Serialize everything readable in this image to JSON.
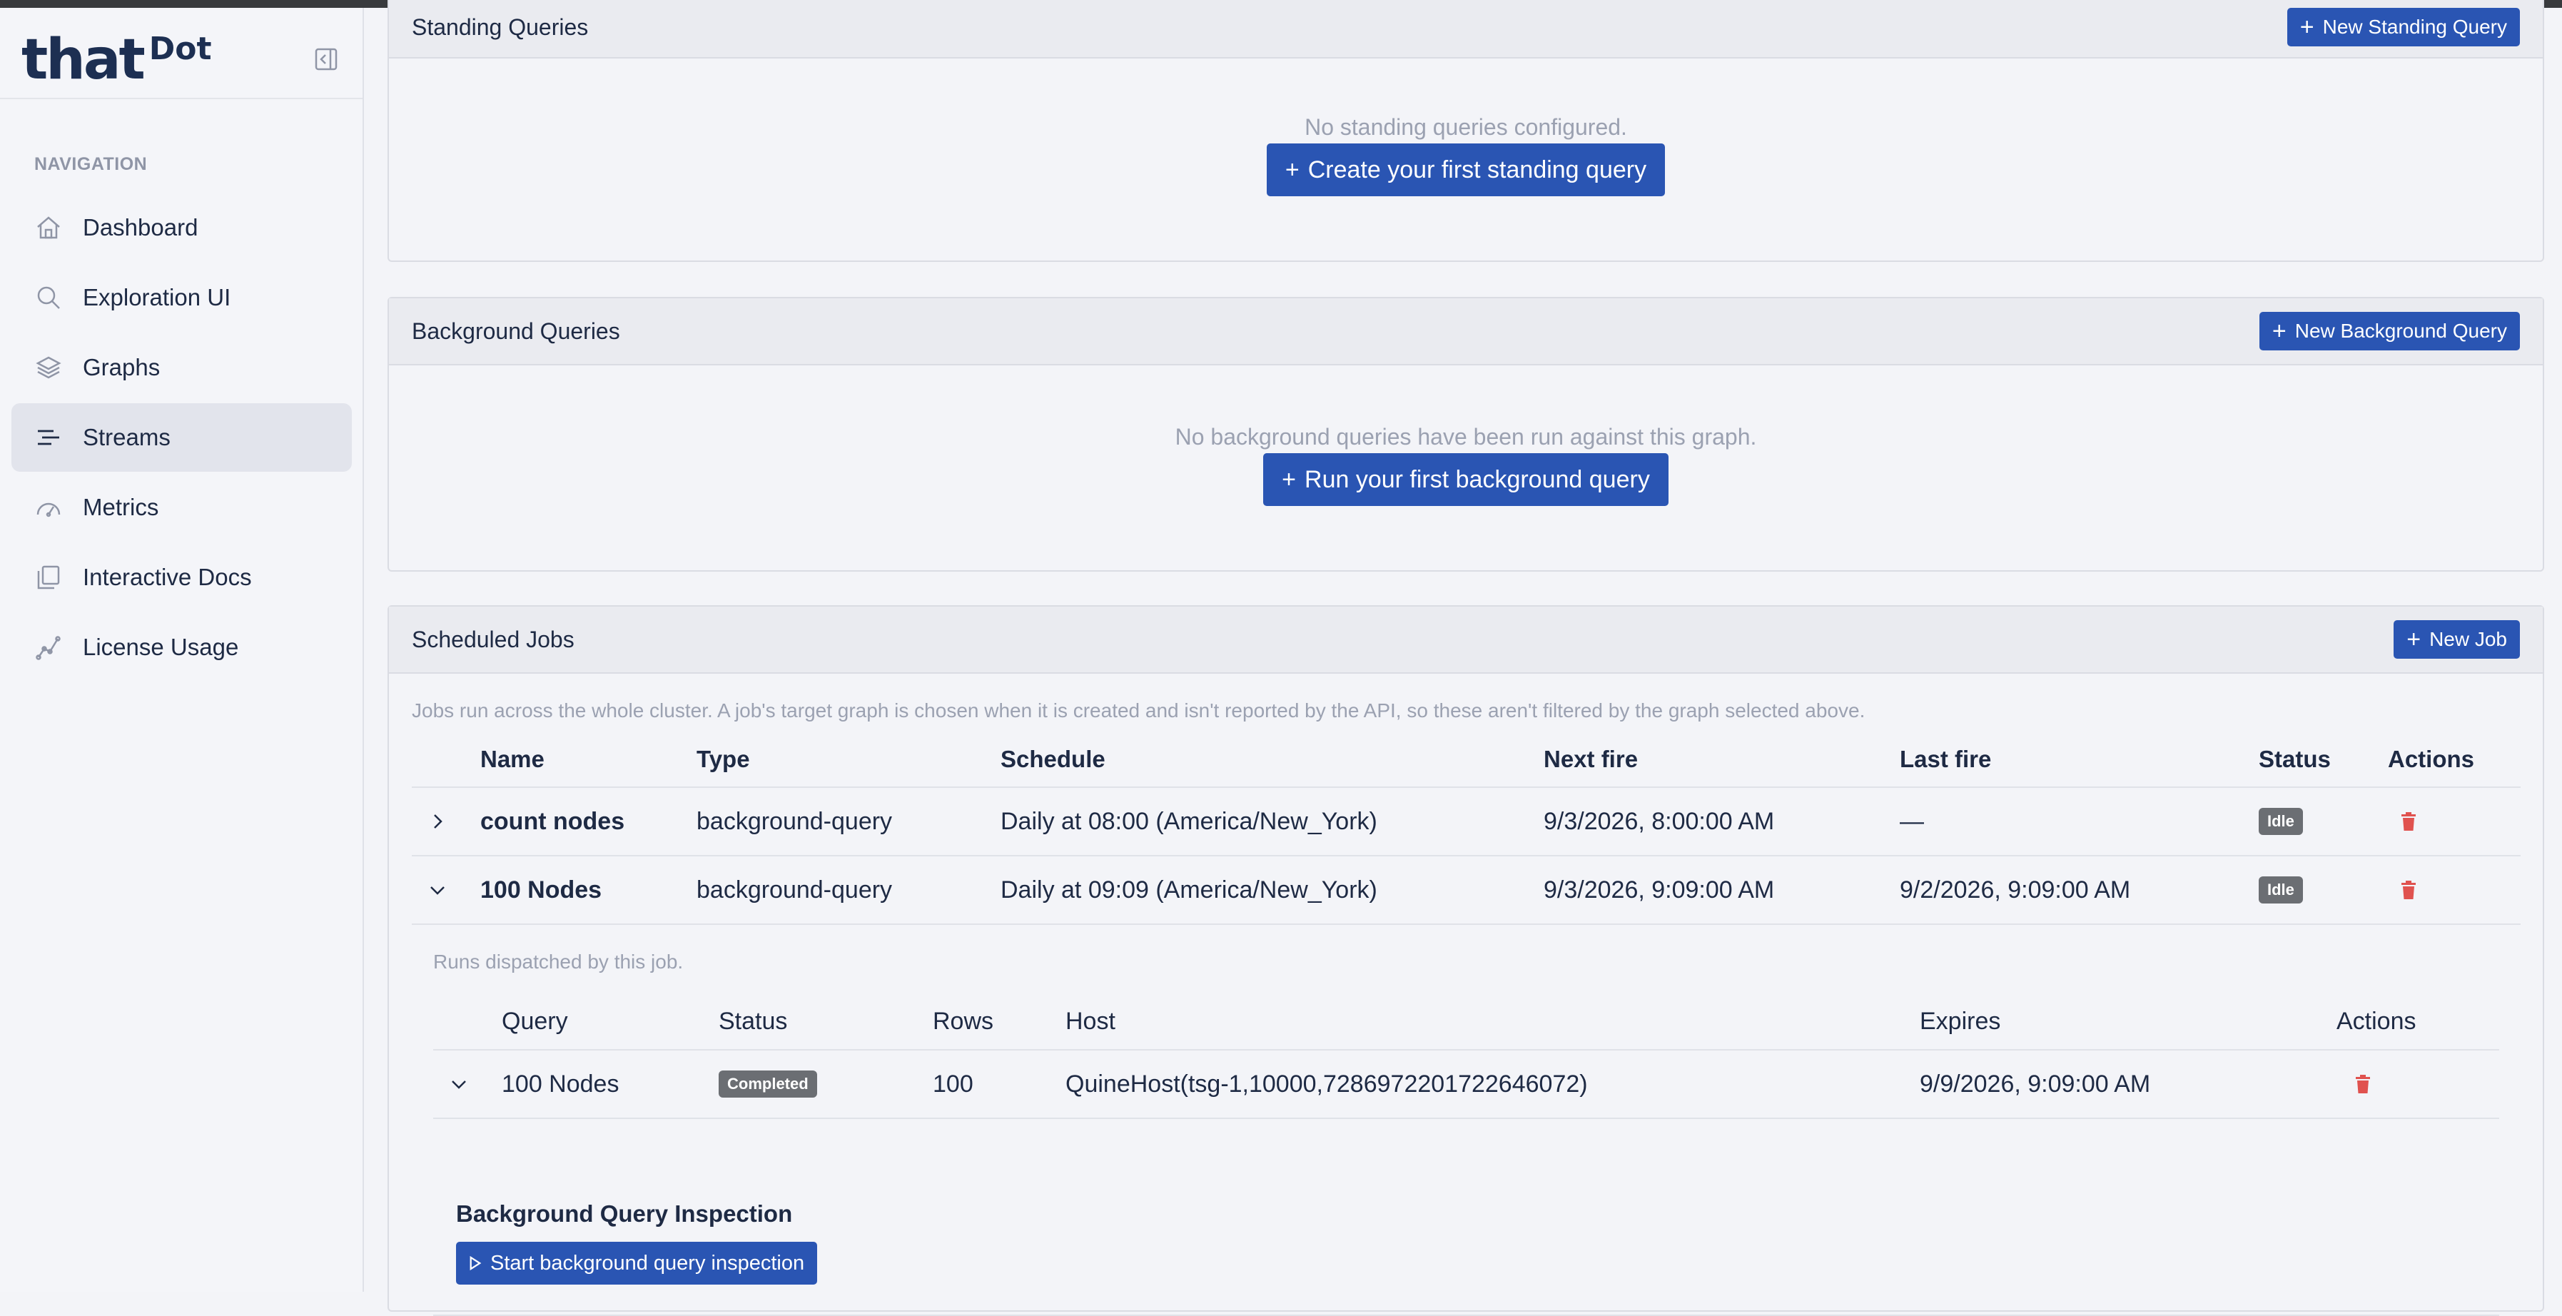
{
  "brand": {
    "that": "that",
    "dot": "Dot"
  },
  "sidebar": {
    "heading": "NAVIGATION",
    "items": [
      {
        "label": "Dashboard",
        "icon": "home-icon"
      },
      {
        "label": "Exploration UI",
        "icon": "search-icon"
      },
      {
        "label": "Graphs",
        "icon": "layers-icon"
      },
      {
        "label": "Streams",
        "icon": "streams-icon",
        "active": true
      },
      {
        "label": "Metrics",
        "icon": "gauge-icon"
      },
      {
        "label": "Interactive Docs",
        "icon": "docs-icon"
      },
      {
        "label": "License Usage",
        "icon": "chart-line-icon"
      }
    ]
  },
  "standing": {
    "title": "Standing Queries",
    "new_label": "New Standing Query",
    "empty_text": "No standing queries configured.",
    "create_label": "Create your first standing query"
  },
  "background": {
    "title": "Background Queries",
    "new_label": "New Background Query",
    "empty_text": "No background queries have been run against this graph.",
    "run_label": "Run your first background query"
  },
  "jobs": {
    "title": "Scheduled Jobs",
    "new_label": "New Job",
    "note": "Jobs run across the whole cluster. A job's target graph is chosen when it is created and isn't reported by the API, so these aren't filtered by the graph selected above.",
    "columns": [
      "Name",
      "Type",
      "Schedule",
      "Next fire",
      "Last fire",
      "Status",
      "Actions"
    ],
    "rows": [
      {
        "name": "count nodes",
        "type": "background-query",
        "schedule": "Daily at 08:00 (America/New_York)",
        "next": "9/3/2026, 8:00:00 AM",
        "last": "—",
        "status": "Idle"
      },
      {
        "name": "100 Nodes",
        "type": "background-query",
        "schedule": "Daily at 09:09 (America/New_York)",
        "next": "9/3/2026, 9:09:00 AM",
        "last": "9/2/2026, 9:09:00 AM",
        "status": "Idle"
      }
    ],
    "runs": {
      "note": "Runs dispatched by this job.",
      "columns": [
        "Query",
        "Status",
        "Rows",
        "Host",
        "Expires",
        "Actions"
      ],
      "row": {
        "query": "100 Nodes",
        "status": "Completed",
        "rows": "100",
        "host": "QuineHost(tsg-1,10000,7286972201722646072)",
        "expires": "9/9/2026, 9:09:00 AM"
      },
      "inspection_title": "Background Query Inspection",
      "inspection_button": "Start background query inspection"
    }
  },
  "colors": {
    "primary": "#2a55b3",
    "badge": "#6b6e73",
    "danger": "#e0524f",
    "text": "#1e2a44",
    "muted": "#9ba1b1"
  }
}
